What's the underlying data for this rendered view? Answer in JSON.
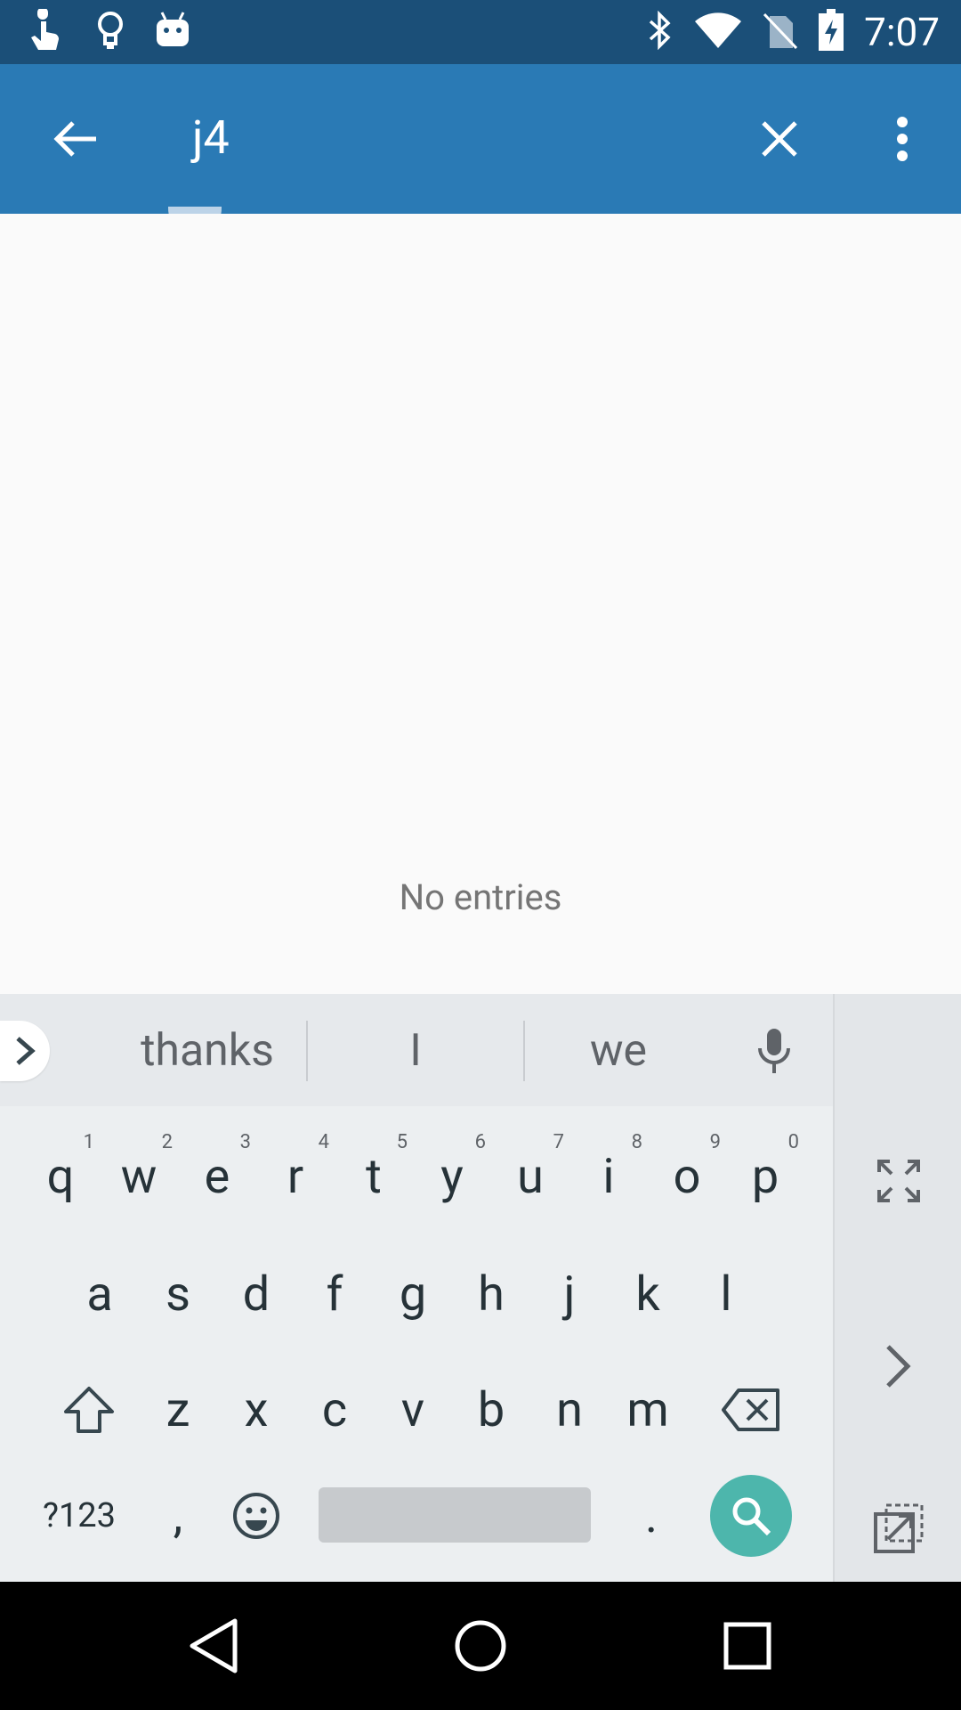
{
  "status_bar": {
    "time": "7:07",
    "icons_left": [
      "touch-gesture-icon",
      "lightbulb-icon",
      "android-icon"
    ],
    "icons_right": [
      "bluetooth-icon",
      "wifi-icon",
      "no-sim-icon",
      "battery-charging-icon"
    ]
  },
  "app_bar": {
    "search_query": "j4",
    "back_icon": "arrow-back-icon",
    "clear_icon": "close-icon",
    "overflow_icon": "more-vert-icon",
    "background": "#2a7ab5"
  },
  "content": {
    "empty_message": "No entries"
  },
  "keyboard": {
    "suggestions": [
      "thanks",
      "I",
      "we"
    ],
    "row1": [
      {
        "key": "q",
        "hint": "1"
      },
      {
        "key": "w",
        "hint": "2"
      },
      {
        "key": "e",
        "hint": "3"
      },
      {
        "key": "r",
        "hint": "4"
      },
      {
        "key": "t",
        "hint": "5"
      },
      {
        "key": "y",
        "hint": "6"
      },
      {
        "key": "u",
        "hint": "7"
      },
      {
        "key": "i",
        "hint": "8"
      },
      {
        "key": "o",
        "hint": "9"
      },
      {
        "key": "p",
        "hint": "0"
      }
    ],
    "row2": [
      "a",
      "s",
      "d",
      "f",
      "g",
      "h",
      "j",
      "k",
      "l"
    ],
    "row3": [
      "z",
      "x",
      "c",
      "v",
      "b",
      "n",
      "m"
    ],
    "symbols_label": "?123",
    "comma": ",",
    "period": ".",
    "action_color": "#4db6ac"
  },
  "nav_bar": {
    "buttons": [
      "back-icon",
      "home-icon",
      "recents-icon"
    ]
  }
}
